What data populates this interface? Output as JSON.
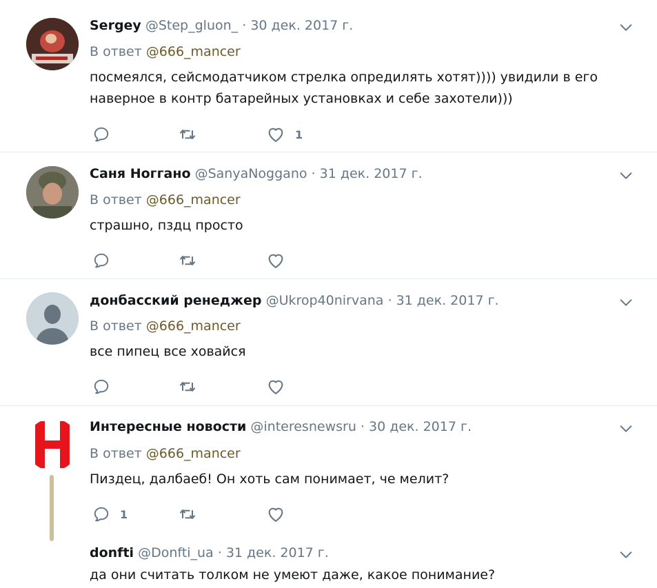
{
  "tweets": [
    {
      "name": "Sergey",
      "handle": "@Step_gluon_",
      "sep": "·",
      "date": "30 дек. 2017 г.",
      "reply_prefix": "В ответ",
      "reply_mention": "@666_mancer",
      "text": "посмеялся, сейсмодатчиком стрелка опредилять хотят))))  увидили в его наверное в контр батарейных установках и себе захотели)))",
      "reply_count": "",
      "like_count": "1"
    },
    {
      "name": "Саня Ноггано",
      "handle": "@SanyaNoggano",
      "sep": "·",
      "date": "31 дек. 2017 г.",
      "reply_prefix": "В ответ",
      "reply_mention": "@666_mancer",
      "text": "страшно, пздц просто",
      "reply_count": "",
      "like_count": ""
    },
    {
      "name": "донбасский ренеджер",
      "handle": "@Ukrop40nirvana",
      "sep": "·",
      "date": "31 дек. 2017 г.",
      "reply_prefix": "В ответ",
      "reply_mention": "@666_mancer",
      "text": "все пипец все  ховайся",
      "reply_count": "",
      "like_count": ""
    },
    {
      "name": "Интересные новости",
      "handle": "@interesnewsru",
      "sep": "·",
      "date": "30 дек. 2017 г.",
      "reply_prefix": "В ответ",
      "reply_mention": "@666_mancer",
      "text": "Пиздец, далбаеб! Он хоть сам понимает, че мелит?",
      "reply_count": "1",
      "like_count": ""
    },
    {
      "name": "donfti",
      "handle": "@Donfti_ua",
      "sep": "·",
      "date": "31 дек. 2017 г.",
      "text": "да они считать толком не умеют даже, какое понимание?"
    }
  ],
  "colors": {
    "icon_gray": "#657786",
    "divider": "#e6ecf0",
    "logo_red": "#e8141b",
    "thread_line": "#cbbf9c"
  },
  "icons": [
    "reply-icon",
    "retweet-icon",
    "like-icon",
    "chevron-down-icon"
  ]
}
